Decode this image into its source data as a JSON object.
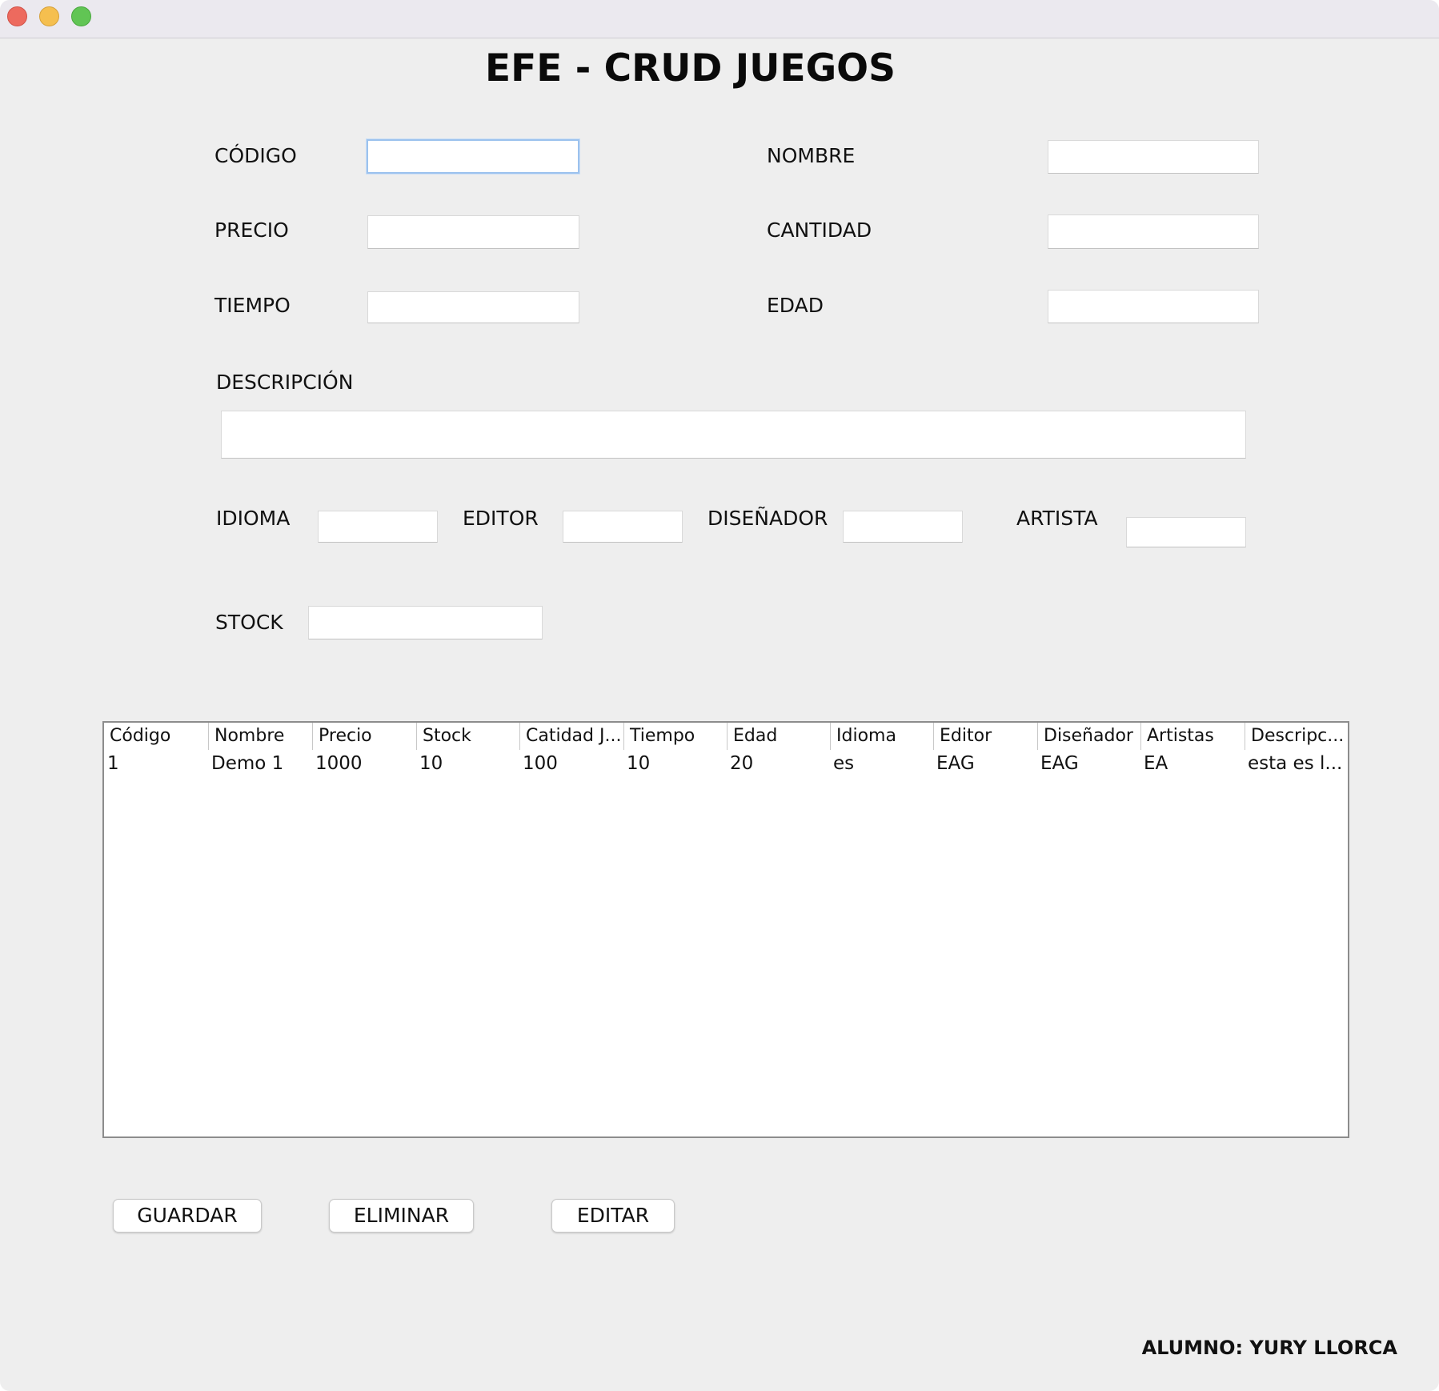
{
  "window": {
    "title": "EFE - CRUD JUEGOS",
    "controls": [
      "close",
      "minimize",
      "maximize"
    ]
  },
  "form": {
    "codigo_label": "CÓDIGO",
    "nombre_label": "NOMBRE",
    "precio_label": "PRECIO",
    "cantidad_label": "CANTIDAD",
    "tiempo_label": "TIEMPO",
    "edad_label": "EDAD",
    "descripcion_label": "DESCRIPCIÓN",
    "idioma_label": "IDIOMA",
    "editor_label": "EDITOR",
    "disenador_label": "DISEÑADOR",
    "artista_label": "ARTISTA",
    "stock_label": "STOCK",
    "codigo_value": "",
    "nombre_value": "",
    "precio_value": "",
    "cantidad_value": "",
    "tiempo_value": "",
    "edad_value": "",
    "descripcion_value": "",
    "idioma_value": "",
    "editor_value": "",
    "disenador_value": "",
    "artista_value": "",
    "stock_value": ""
  },
  "table": {
    "columns": [
      "Código",
      "Nombre",
      "Precio",
      "Stock",
      "Catidad J...",
      "Tiempo",
      "Edad",
      "Idioma",
      "Editor",
      "Diseñador",
      "Artistas",
      "Descripc..."
    ],
    "rows": [
      [
        "1",
        "Demo 1",
        "1000",
        "10",
        "100",
        "10",
        "20",
        "es",
        "EAG",
        "EAG",
        "EA",
        "esta es l..."
      ]
    ]
  },
  "buttons": {
    "guardar": "GUARDAR",
    "eliminar": "ELIMINAR",
    "editar": "EDITAR"
  },
  "footer": {
    "student": "ALUMNO: YURY LLORCA"
  },
  "colors": {
    "background": "#eeeeee",
    "titlebar": "#ebe9ef",
    "focus_ring": "#9cc2ee",
    "close": "#ed6a5e",
    "minimize": "#f5bf4f",
    "maximize": "#61c554"
  }
}
